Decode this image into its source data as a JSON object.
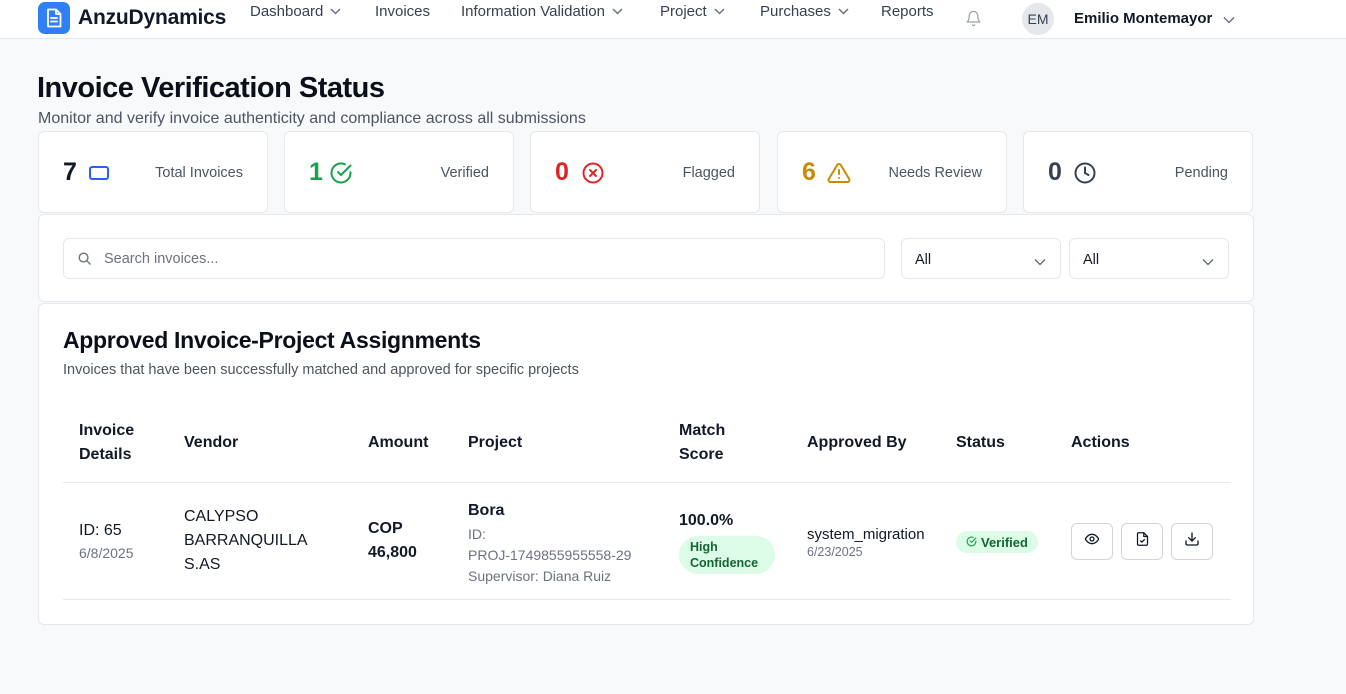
{
  "app": {
    "name": "AnzuDynamics"
  },
  "nav": {
    "items": [
      "Dashboard",
      "Invoices",
      "Information Validation",
      "Project",
      "Purchases",
      "Reports"
    ]
  },
  "user": {
    "initials": "EM",
    "name": "Emilio Montemayor"
  },
  "page": {
    "title": "Invoice Verification Status",
    "subtitle": "Monitor and verify invoice authenticity and compliance across all submissions"
  },
  "stats": [
    {
      "value": "7",
      "label": "Total Invoices",
      "color": "#111827",
      "icon": "invoice-icon",
      "icon_color": "#2563eb"
    },
    {
      "value": "1",
      "label": "Verified",
      "color": "#16a34a",
      "icon": "check-circle-icon",
      "icon_color": "#16a34a"
    },
    {
      "value": "0",
      "label": "Flagged",
      "color": "#dc2626",
      "icon": "x-circle-icon",
      "icon_color": "#dc2626"
    },
    {
      "value": "6",
      "label": "Needs Review",
      "color": "#ca8a04",
      "icon": "warning-icon",
      "icon_color": "#ca8a04"
    },
    {
      "value": "0",
      "label": "Pending",
      "color": "#374151",
      "icon": "clock-icon",
      "icon_color": "#374151"
    }
  ],
  "filters": {
    "search_placeholder": "Search invoices...",
    "select1": "All",
    "select2": "All"
  },
  "table": {
    "title": "Approved Invoice-Project Assignments",
    "subtitle": "Invoices that have been successfully matched and approved for specific projects",
    "headers": {
      "invoice_details": [
        "Invoice",
        "Details"
      ],
      "vendor": "Vendor",
      "amount": "Amount",
      "project": "Project",
      "match_score": [
        "Match",
        "Score"
      ],
      "approved_by": "Approved By",
      "status": "Status",
      "actions": "Actions"
    },
    "rows": [
      {
        "id": "ID: 65",
        "date": "6/8/2025",
        "vendor": [
          "CALYPSO",
          "BARRANQUILLA",
          "S.AS"
        ],
        "amount": [
          "COP",
          "46,800"
        ],
        "project_name": "Bora",
        "project_id": [
          "ID:",
          "PROJ-1749855955558-29"
        ],
        "supervisor": "Supervisor: Diana Ruiz",
        "score": "100.0%",
        "confidence": [
          "High",
          "Confidence"
        ],
        "approved_by": "system_migration",
        "approved_date": "6/23/2025",
        "status": "Verified"
      }
    ]
  },
  "colors": {
    "brand": "#2f7ff5",
    "verified_bg": "#dcfce7",
    "verified_text": "#166534"
  }
}
